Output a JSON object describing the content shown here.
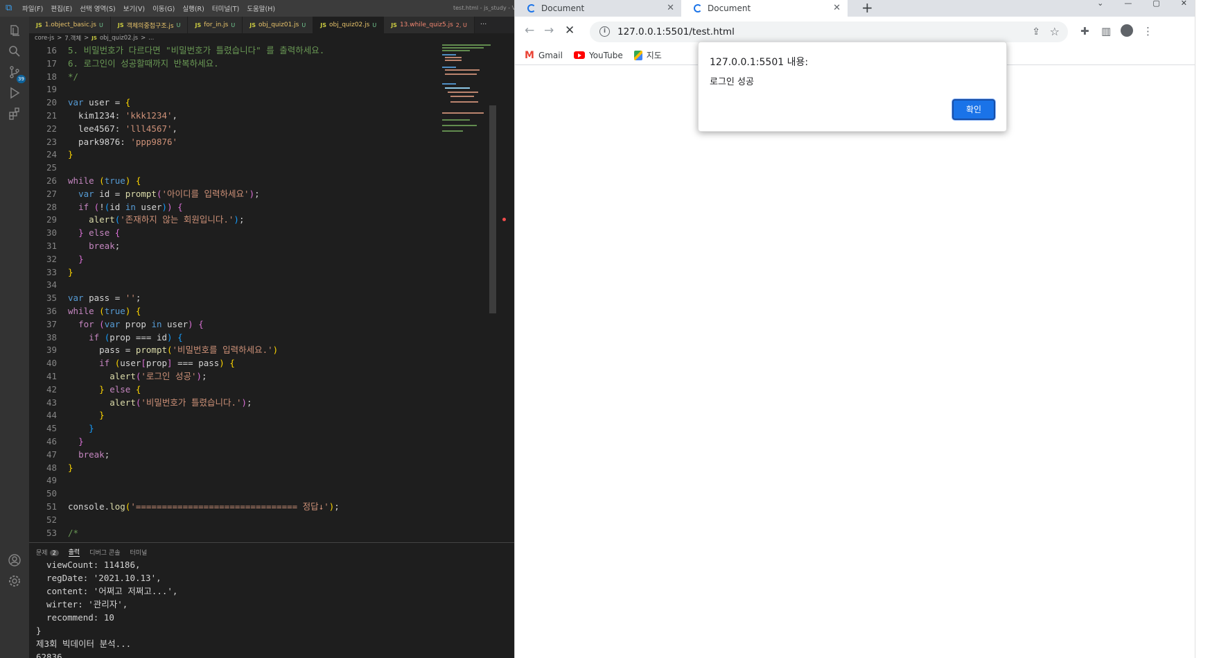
{
  "vscode": {
    "menu": [
      "파일(F)",
      "편집(E)",
      "선택 영역(S)",
      "보기(V)",
      "이동(G)",
      "실행(R)",
      "터미널(T)",
      "도움말(H)"
    ],
    "window_title": "test.html - js_study - Vi",
    "scm_badge": "39",
    "tabs": [
      {
        "label": "1.object_basic.js",
        "status": "U"
      },
      {
        "label": "객체의중첩구조.js",
        "status": "U"
      },
      {
        "label": "for_in.js",
        "status": "U"
      },
      {
        "label": "obj_quiz01.js",
        "status": "U"
      },
      {
        "label": "obj_quiz02.js",
        "status": "U"
      },
      {
        "label": "13.while_quiz5.js",
        "status": "2, U"
      }
    ],
    "more": "···",
    "breadcrumb": [
      "core-js",
      ">",
      "7.객체",
      ">",
      "JS",
      "obj_quiz02.js",
      ">",
      "..."
    ],
    "line_numbers": [
      "16",
      "17",
      "18",
      "19",
      "20",
      "21",
      "22",
      "23",
      "24",
      "25",
      "26",
      "27",
      "28",
      "29",
      "30",
      "31",
      "32",
      "33",
      "34",
      "35",
      "36",
      "37",
      "38",
      "39",
      "40",
      "41",
      "42",
      "43",
      "44",
      "45",
      "46",
      "47",
      "48",
      "49",
      "50",
      "51",
      "52",
      "53"
    ],
    "panel": {
      "tabs": [
        "문제",
        "출력",
        "디버그 콘솔",
        "터미널"
      ],
      "problem_count": "2",
      "output_lines": [
        "  viewCount: 114186,",
        "  regDate: '2021.10.13',",
        "  content: '어쩌고 저쩌고...',",
        "  wirter: '관리자',",
        "  recommend: 10",
        "}",
        "제3회 빅데이터 분석...",
        "62836"
      ]
    }
  },
  "chrome": {
    "tabs": [
      {
        "label": "Document"
      },
      {
        "label": "Document"
      }
    ],
    "new_tab": "+",
    "url": "127.0.0.1:5501/test.html",
    "bookmarks": [
      "Gmail",
      "YouTube",
      "지도"
    ],
    "dialog": {
      "title": "127.0.0.1:5501 내용:",
      "message": "로그인 성공",
      "ok_label": "확인"
    },
    "accent": "#1a73e8"
  }
}
